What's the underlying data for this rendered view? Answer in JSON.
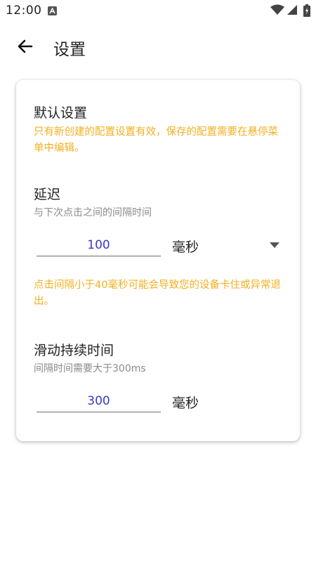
{
  "status_bar": {
    "time": "12:00",
    "icons": [
      "a-notification-icon",
      "wifi-icon",
      "signal-icon",
      "battery-icon"
    ]
  },
  "app_bar": {
    "title": "设置",
    "back_icon": "arrow-left-icon"
  },
  "card": {
    "default_settings": {
      "title": "默认设置",
      "notice": "只有新创建的配置设置有效，保存的配置需要在悬停菜单中编辑。"
    },
    "delay": {
      "title": "延迟",
      "subtitle": "与下次点击之间的间隔时间",
      "value": "100",
      "unit": "毫秒",
      "warning": "点击间隔小于40毫秒可能会导致您的设备卡住或异常退出。"
    },
    "swipe_duration": {
      "title": "滑动持续时间",
      "subtitle": "间隔时间需要大于300ms",
      "value": "300",
      "unit": "毫秒"
    }
  },
  "colors": {
    "warning": "#f2b021",
    "input_text": "#3a39c8",
    "subtitle": "#8a8a8a"
  }
}
